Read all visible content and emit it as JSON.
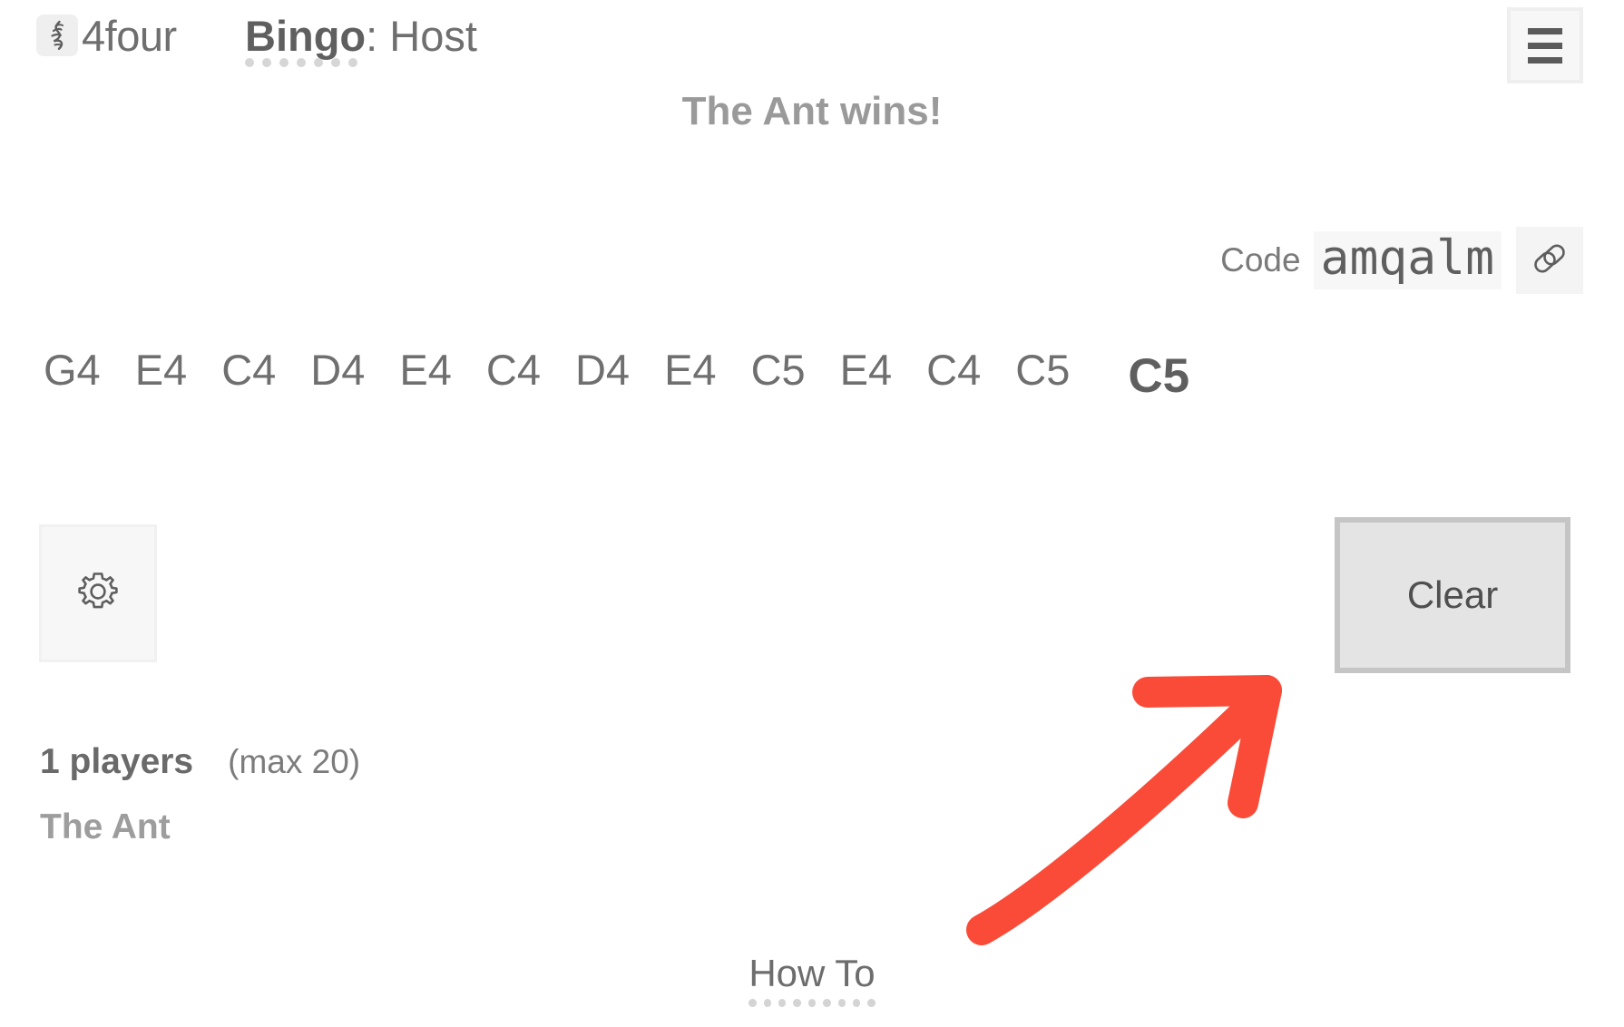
{
  "header": {
    "logo_icon": "music-rest-icon",
    "brand": "4four",
    "game_name": "Bingo",
    "role_separator": ": ",
    "role": "Host",
    "menu_icon": "hamburger-menu-icon",
    "underline_dots": 7
  },
  "banner": {
    "text": "The Ant wins!"
  },
  "code": {
    "label": "Code",
    "value": "amqalm",
    "copy_icon": "link-icon"
  },
  "notes": {
    "history": [
      "G4",
      "E4",
      "C4",
      "D4",
      "E4",
      "C4",
      "D4",
      "E4",
      "C5",
      "E4",
      "C4",
      "C5"
    ],
    "current": "C5"
  },
  "controls": {
    "settings_icon": "gear-icon",
    "clear_label": "Clear"
  },
  "players": {
    "count_label": "1 players",
    "max_label": "(max 20)",
    "list": [
      "The Ant"
    ]
  },
  "footer": {
    "howto_label": "How To",
    "howto_dots": 9
  },
  "annotation": {
    "arrow_color": "#FA4B38",
    "arrow_points_to": "clear-button"
  },
  "colors": {
    "text_gray": "#6f6f6f",
    "muted_gray": "#9a9a9a",
    "panel_gray": "#f7f7f7",
    "button_fill": "#e4e4e4",
    "button_border": "#c5c5c5",
    "accent_red": "#FA4B38"
  }
}
